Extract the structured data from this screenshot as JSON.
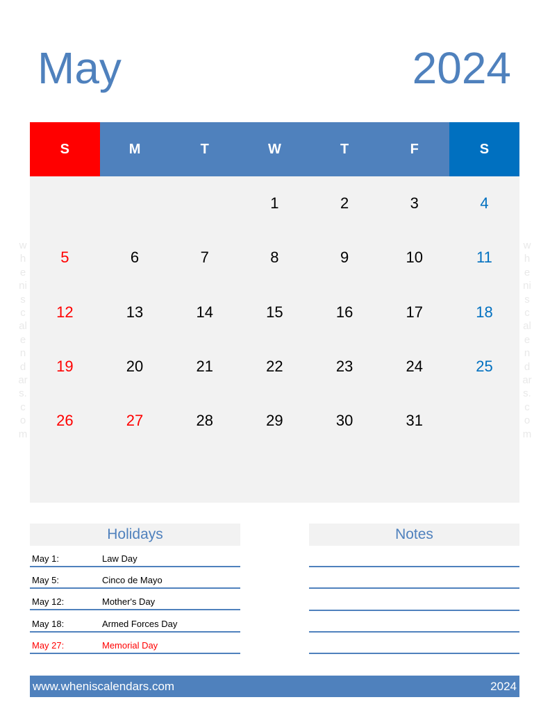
{
  "header": {
    "month": "May",
    "year": "2024"
  },
  "watermark": {
    "letters": [
      "w",
      "h",
      "e",
      "ni",
      "s",
      "c",
      "al",
      "e",
      "n",
      "d",
      "ar",
      "s.",
      "c",
      "o",
      "m"
    ]
  },
  "calendar": {
    "weekdays": [
      "S",
      "M",
      "T",
      "W",
      "T",
      "F",
      "S"
    ],
    "weeks": [
      [
        {
          "day": "",
          "color": ""
        },
        {
          "day": "",
          "color": ""
        },
        {
          "day": "",
          "color": ""
        },
        {
          "day": "1",
          "color": ""
        },
        {
          "day": "2",
          "color": ""
        },
        {
          "day": "3",
          "color": ""
        },
        {
          "day": "4",
          "color": "blue"
        }
      ],
      [
        {
          "day": "5",
          "color": "red"
        },
        {
          "day": "6",
          "color": ""
        },
        {
          "day": "7",
          "color": ""
        },
        {
          "day": "8",
          "color": ""
        },
        {
          "day": "9",
          "color": ""
        },
        {
          "day": "10",
          "color": ""
        },
        {
          "day": "11",
          "color": "blue"
        }
      ],
      [
        {
          "day": "12",
          "color": "red"
        },
        {
          "day": "13",
          "color": ""
        },
        {
          "day": "14",
          "color": ""
        },
        {
          "day": "15",
          "color": ""
        },
        {
          "day": "16",
          "color": ""
        },
        {
          "day": "17",
          "color": ""
        },
        {
          "day": "18",
          "color": "blue"
        }
      ],
      [
        {
          "day": "19",
          "color": "red"
        },
        {
          "day": "20",
          "color": ""
        },
        {
          "day": "21",
          "color": ""
        },
        {
          "day": "22",
          "color": ""
        },
        {
          "day": "23",
          "color": ""
        },
        {
          "day": "24",
          "color": ""
        },
        {
          "day": "25",
          "color": "blue"
        }
      ],
      [
        {
          "day": "26",
          "color": "red"
        },
        {
          "day": "27",
          "color": "red"
        },
        {
          "day": "28",
          "color": ""
        },
        {
          "day": "29",
          "color": ""
        },
        {
          "day": "30",
          "color": ""
        },
        {
          "day": "31",
          "color": ""
        },
        {
          "day": "",
          "color": ""
        }
      ],
      [
        {
          "day": "",
          "color": ""
        },
        {
          "day": "",
          "color": ""
        },
        {
          "day": "",
          "color": ""
        },
        {
          "day": "",
          "color": ""
        },
        {
          "day": "",
          "color": ""
        },
        {
          "day": "",
          "color": ""
        },
        {
          "day": "",
          "color": ""
        }
      ]
    ],
    "colors": {
      "sunday": "#ff0000",
      "saturday": "#0070c0",
      "weekday_header": "#4f81bd"
    }
  },
  "holidays": {
    "title": "Holidays",
    "items": [
      {
        "date": "May 1:",
        "name": "Law Day",
        "highlight": false
      },
      {
        "date": "May 5:",
        "name": "Cinco de Mayo",
        "highlight": false
      },
      {
        "date": "May 12:",
        "name": "Mother's Day",
        "highlight": false
      },
      {
        "date": "May 18:",
        "name": "Armed Forces Day",
        "highlight": false
      },
      {
        "date": "May 27:",
        "name": "Memorial Day",
        "highlight": true
      }
    ]
  },
  "notes": {
    "title": "Notes",
    "line_count": 5
  },
  "footer": {
    "website": "www.wheniscalendars.com",
    "year": "2024"
  }
}
